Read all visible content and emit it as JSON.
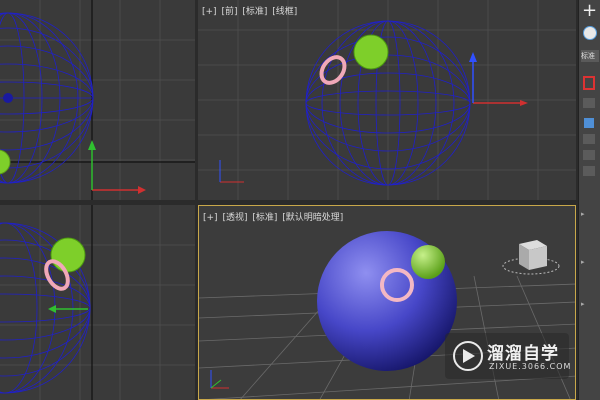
{
  "viewports": {
    "top_left": {
      "label": ""
    },
    "front": {
      "labels": [
        "[+]",
        "[前]",
        "[标准]",
        "[线框]"
      ]
    },
    "bottom_left": {
      "label": ""
    },
    "perspective": {
      "labels": [
        "[+]",
        "[透视]",
        "[标准]",
        "[默认明暗处理]"
      ]
    }
  },
  "sidebar": {
    "plus_label": "+",
    "dropdown_label": "标准"
  },
  "watermark": {
    "title": "溜溜自学",
    "url": "ZIXUE.3066.COM"
  },
  "colors": {
    "viewport_bg": "#3a3a3a",
    "grid": "#4b4b4b",
    "wire_sphere": "#2020c8",
    "green_ball": "#7ecf2a",
    "torus": "#f0a8b8",
    "active_border": "#c9a84a",
    "axis_red": "#d03030",
    "axis_green": "#30c030",
    "axis_blue": "#3050ff"
  }
}
